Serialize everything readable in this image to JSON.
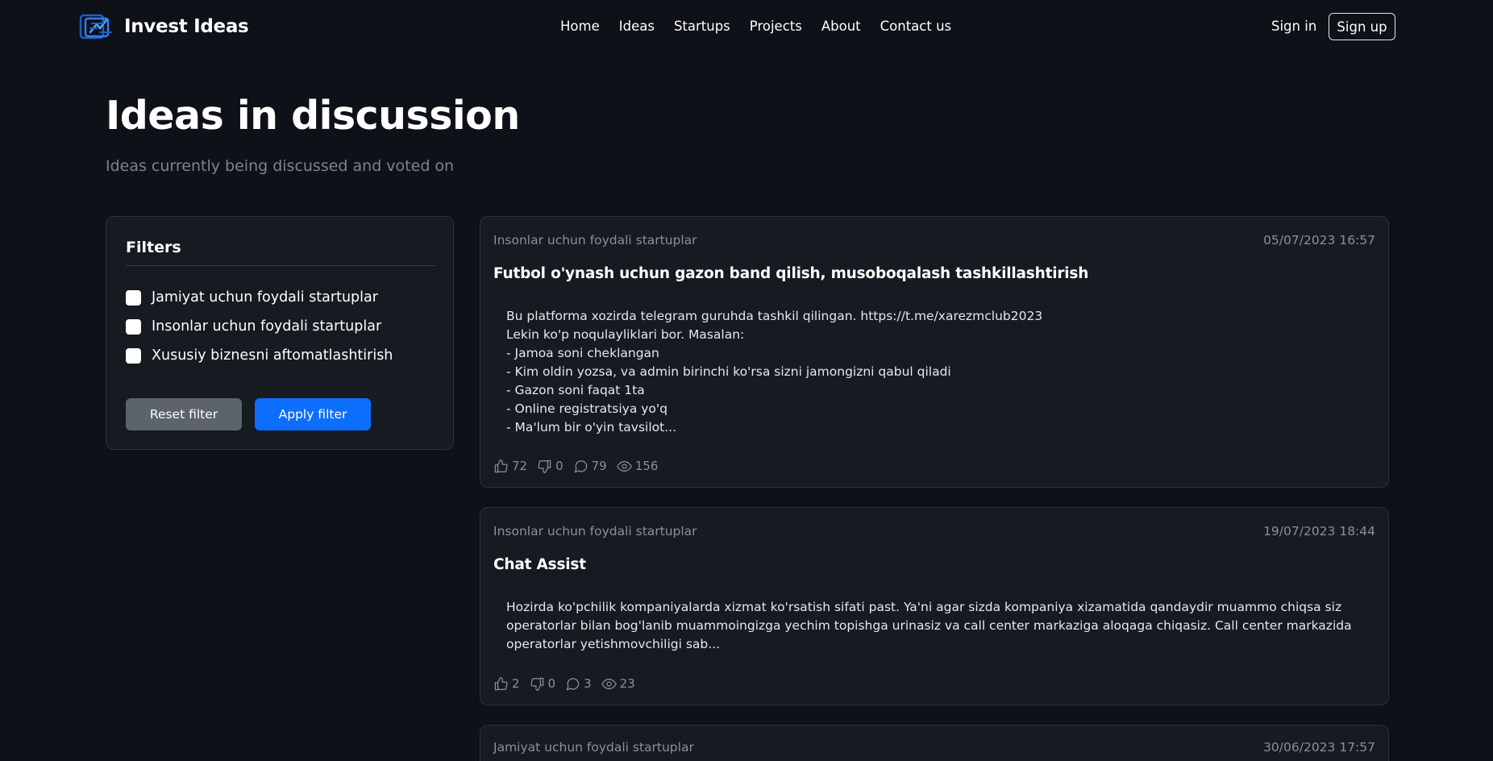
{
  "navbar": {
    "brand": "Invest Ideas",
    "links": [
      "Home",
      "Ideas",
      "Startups",
      "Projects",
      "About",
      "Contact us"
    ],
    "signin": "Sign in",
    "signup": "Sign up"
  },
  "header": {
    "title": "Ideas in discussion",
    "subtitle": "Ideas currently being discussed and voted on"
  },
  "filters": {
    "title": "Filters",
    "options": [
      {
        "label": "Jamiyat uchun foydali startuplar",
        "checked": false
      },
      {
        "label": "Insonlar uchun foydali startuplar",
        "checked": false
      },
      {
        "label": "Xususiy biznesni aftomatlashtirish",
        "checked": false
      }
    ],
    "reset_label": "Reset filter",
    "apply_label": "Apply filter"
  },
  "ideas": [
    {
      "category": "Insonlar uchun foydali startuplar",
      "date": "05/07/2023 16:57",
      "title": "Futbol o'ynash uchun gazon band qilish, musoboqalash tashkillashtirish",
      "body": "Bu platforma xozirda telegram guruhda tashkil qilingan. https://t.me/xarezmclub2023\nLekin ko'p noqulayliklari bor. Masalan:\n- Jamoa soni cheklangan\n- Kim oldin yozsa, va admin birinchi ko'rsa sizni jamongizni qabul qiladi\n- Gazon soni faqat 1ta\n- Online registratsiya yo'q\n- Ma'lum bir o'yin tavsilot...",
      "likes": "72",
      "dislikes": "0",
      "comments": "79",
      "views": "156"
    },
    {
      "category": "Insonlar uchun foydali startuplar",
      "date": "19/07/2023 18:44",
      "title": "Chat Assist",
      "body": "    Hozirda ko'pchilik kompaniyalarda xizmat ko'rsatish sifati past. Ya'ni  agar sizda kompaniya xizamatida qandaydir muammo chiqsa siz operatorlar bilan bog'lanib muammoingizga yechim topishga urinasiz va call center markaziga aloqaga chiqasiz. Call center markazida operatorlar yetishmovchiligi sab...",
      "likes": "2",
      "dislikes": "0",
      "comments": "3",
      "views": "23"
    },
    {
      "category": "Jamiyat uchun foydali startuplar",
      "date": "30/06/2023 17:57"
    }
  ]
}
